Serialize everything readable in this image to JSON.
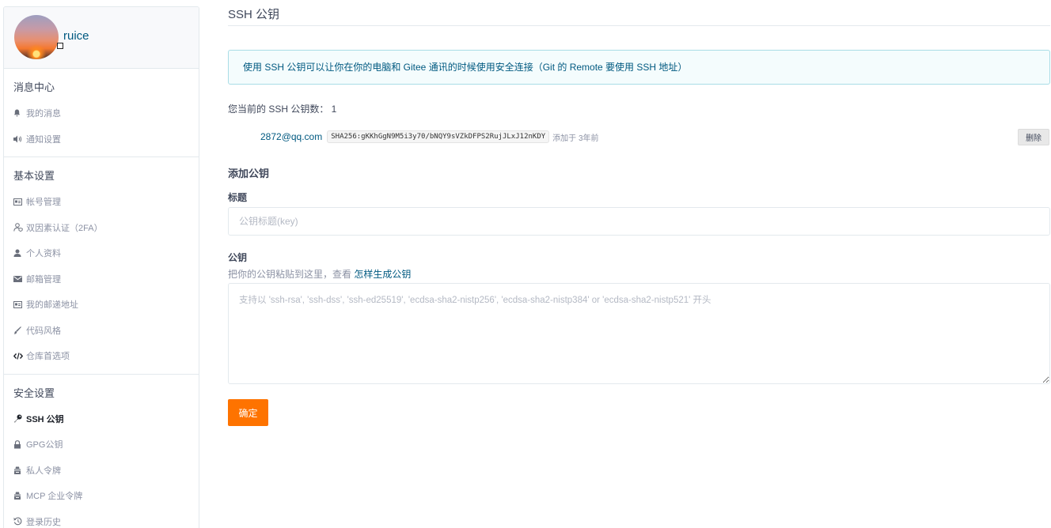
{
  "sidebar": {
    "username": "ruice",
    "sections": [
      {
        "title": "消息中心",
        "items": [
          {
            "label": "我的消息",
            "icon": "bell-icon"
          },
          {
            "label": "通知设置",
            "icon": "volume-icon"
          }
        ]
      },
      {
        "title": "基本设置",
        "items": [
          {
            "label": "帐号管理",
            "icon": "id-card-icon"
          },
          {
            "label": "双因素认证（2FA）",
            "icon": "user-shield-icon"
          },
          {
            "label": "个人资料",
            "icon": "user-icon"
          },
          {
            "label": "邮箱管理",
            "icon": "envelope-icon"
          },
          {
            "label": "我的邮递地址",
            "icon": "address-card-icon"
          },
          {
            "label": "代码风格",
            "icon": "brush-icon"
          },
          {
            "label": "仓库首选项",
            "icon": "code-icon"
          }
        ]
      },
      {
        "title": "安全设置",
        "items": [
          {
            "label": "SSH 公钥",
            "icon": "key-icon",
            "active": true
          },
          {
            "label": "GPG公钥",
            "icon": "lock-icon"
          },
          {
            "label": "私人令牌",
            "icon": "token-icon"
          },
          {
            "label": "MCP 企业令牌",
            "icon": "token-icon"
          },
          {
            "label": "登录历史",
            "icon": "history-icon"
          }
        ]
      }
    ]
  },
  "main": {
    "page_title": "SSH 公钥",
    "info_text": "使用 SSH 公钥可以让你在你的电脑和 Gitee 通讯的时候使用安全连接（Git 的 Remote 要使用 SSH 地址）",
    "key_count_text": "您当前的 SSH 公钥数： 1",
    "key": {
      "email": "2872@qq.com",
      "fingerprint": "SHA256:gKKhGgN9M5i3y70/bNQY9sVZkDFPS2RujJLxJ12nKDY",
      "added": "添加于 3年前",
      "delete_label": "删除"
    },
    "add_title": "添加公钥",
    "title_label": "标题",
    "title_placeholder": "公钥标题(key)",
    "key_label": "公钥",
    "hint_prefix": "把你的公钥粘贴到这里，查看",
    "hint_link": "怎样生成公钥",
    "key_placeholder": "支持以 'ssh-rsa', 'ssh-dss', 'ssh-ed25519', 'ecdsa-sha2-nistp256', 'ecdsa-sha2-nistp384' or 'ecdsa-sha2-nistp521' 开头",
    "submit_label": "确定"
  },
  "colors": {
    "accent": "#fe7300",
    "link": "#005980",
    "info_bg": "#f4fcfd",
    "info_border": "#a9dde6"
  }
}
